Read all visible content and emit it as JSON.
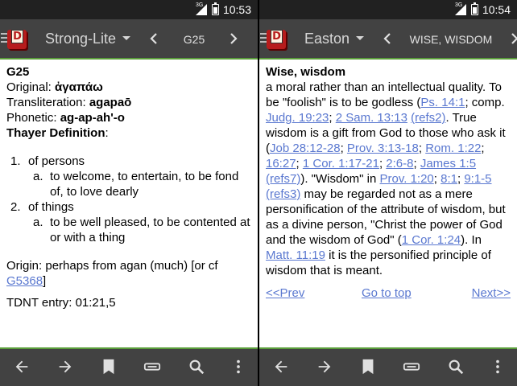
{
  "left": {
    "status": {
      "time": "10:53",
      "network": "3G"
    },
    "toolbar": {
      "module": "Strong-Lite",
      "key": "G25"
    },
    "entry": {
      "key": "G25",
      "original_label": "Original:",
      "original_value": "ἀγαπάω",
      "translit_label": "Transliteration:",
      "translit_value": "agapaō",
      "phonetic_label": "Phonetic:",
      "phonetic_value": "ag-ap-ah'-o",
      "thayer_label": "Thayer Definition",
      "thayer_colon": ":",
      "defs": [
        {
          "num": "1.",
          "text": "of persons",
          "sub_letter": "a.",
          "sub_text": "to welcome, to entertain, to be fond of, to love dearly"
        },
        {
          "num": "2.",
          "text": "of things",
          "sub_letter": "a.",
          "sub_text": "to be well pleased, to be contented at or with a thing"
        }
      ],
      "origin_text": "Origin: perhaps from agan (much) [or cf ",
      "origin_link": "G5368",
      "origin_end": "]",
      "tdnt": "TDNT entry: 01:21,5"
    }
  },
  "right": {
    "status": {
      "time": "10:54",
      "network": "3G"
    },
    "toolbar": {
      "module": "Easton",
      "key": "WISE, WISDOM"
    },
    "entry": {
      "title": "Wise, wisdom",
      "t1": "a moral rather than an intellectual quality. To be \"foolish\" is to be godless (",
      "l1": "Ps. 14:1",
      "t2": "; comp. ",
      "l2": "Judg. 19:23",
      "t3": "; ",
      "l3": "2 Sam. 13:13",
      "t4": " ",
      "l4": "(refs2)",
      "t5": ". True wisdom is a gift from God to those who ask it (",
      "l5": "Job 28:12-28",
      "t6": "; ",
      "l6": "Prov. 3:13-18",
      "t7": "; ",
      "l7": "Rom. 1:22",
      "t8": "; ",
      "l8": "16:27",
      "t9": "; ",
      "l9": "1 Cor. 1:17-21",
      "t10": "; ",
      "l10": "2:6-8",
      "t11": "; ",
      "l11": "James 1:5",
      "t12": " ",
      "l12": "(refs7)",
      "t13": "). \"Wisdom\" in ",
      "l13": "Prov. 1:20",
      "t14": "; ",
      "l14": "8:1",
      "t15": "; ",
      "l15": "9:1-5",
      "t16": " ",
      "l16": "(refs3)",
      "t17": " may be regarded not as a mere personification of the attribute of wisdom, but as a divine person, \"Christ the power of God and the wisdom of God\" (",
      "l17": "1 Cor. 1:24",
      "t18": "). In ",
      "l18": "Matt. 11:19",
      "t19": " it is the personified principle of wisdom that is meant.",
      "prev": "<<Prev",
      "goto_top": "Go to top",
      "next": "Next>>"
    }
  },
  "icons": {
    "back": "arrow-left-icon",
    "forward": "arrow-right-icon",
    "bookmark": "bookmark-icon",
    "window": "window-icon",
    "search": "search-icon",
    "menu": "overflow-menu-icon"
  },
  "colors": {
    "toolbar": "#424242",
    "statusbar": "#212121",
    "accent": "#5a9e3a",
    "link": "#5a78d0"
  }
}
